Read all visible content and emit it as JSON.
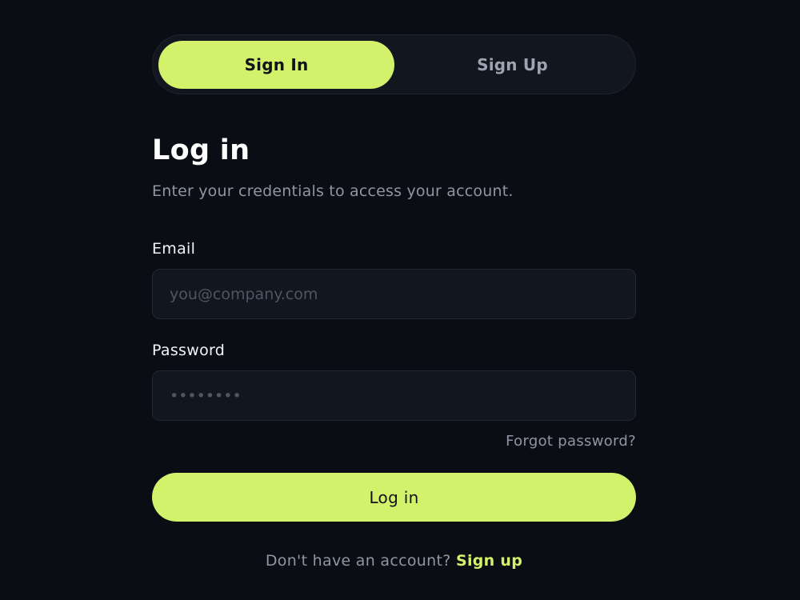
{
  "auth_tabs": {
    "sign_in_label": "Sign In",
    "sign_up_label": "Sign Up",
    "active": "Sign In"
  },
  "form": {
    "title": "Log in",
    "subtitle": "Enter your credentials to access your account.",
    "email": {
      "label": "Email",
      "placeholder": "you@company.com",
      "value": ""
    },
    "password": {
      "label": "Password",
      "placeholder": "••••••••",
      "value": ""
    },
    "forgot_password_label": "Forgot password?",
    "submit_label": "Log in"
  },
  "footer": {
    "prompt": "Don't have an account?",
    "sign_up_link": "Sign up"
  },
  "colors": {
    "background": "#0a0d13",
    "accent": "#d2f26b",
    "surface": "#12161f",
    "muted_text": "#8f95a3"
  }
}
